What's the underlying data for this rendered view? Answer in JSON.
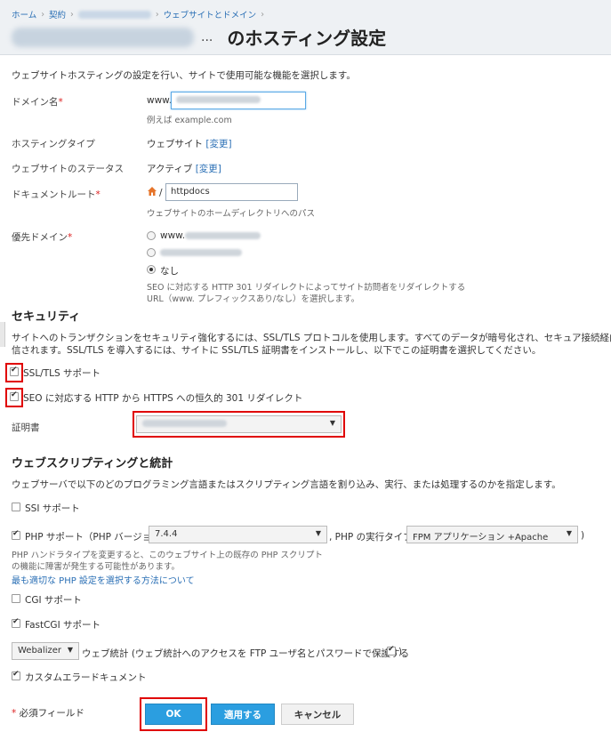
{
  "breadcrumb": {
    "home": "ホーム",
    "contract": "契約",
    "sites": "ウェブサイトとドメイン"
  },
  "page": {
    "dots": "...",
    "title_suffix": "のホスティング設定"
  },
  "intro": "ウェブサイトホスティングの設定を行い、サイトで使用可能な機能を選択します。",
  "domain": {
    "label": "ドメイン名",
    "required_mark": "*",
    "prefix": "www.",
    "hint": "例えば example.com"
  },
  "hosting_type": {
    "label": "ホスティングタイプ",
    "value": "ウェブサイト",
    "change": "[変更]"
  },
  "status": {
    "label": "ウェブサイトのステータス",
    "value": "アクティブ",
    "change": "[変更]"
  },
  "docroot": {
    "label": "ドキュメントルート",
    "required_mark": "*",
    "slash": "/",
    "value": "httpdocs",
    "hint": "ウェブサイトのホームディレクトリへのパス"
  },
  "preferred": {
    "label": "優先ドメイン",
    "required_mark": "*",
    "option1_prefix": "www.",
    "option3": "なし",
    "hint1": "SEO に対応する HTTP 301 リダイレクトによってサイト訪問者をリダイレクトする",
    "hint2": "URL（www. プレフィックスあり/なし）を選択します。"
  },
  "security": {
    "heading": "セキュリティ",
    "desc1": "サイトへのトランザクションをセキュリティ強化するには、SSL/TLS プロトコルを使用します。すべてのデータが暗号化され、セキュア接続経由で送",
    "desc2": "信されます。SSL/TLS を導入するには、サイトに SSL/TLS 証明書をインストールし、以下でこの証明書を選択してください。",
    "ssl_support": "SSL/TLS サポート",
    "redirect": "SEO に対応する HTTP から HTTPS への恒久的 301 リダイレクト",
    "cert_label": "証明書"
  },
  "scripting": {
    "heading": "ウェブスクリプティングと統計",
    "desc": "ウェブサーバで以下のどのプログラミング言語またはスクリプティング言語を割り込み、実行、または処理するのかを指定します。",
    "ssi": "SSI サポート",
    "php": "PHP サポート（PHP バージョン",
    "php_version": "7.4.4",
    "php_type_label": ", PHP の実行タイプ",
    "php_type": "FPM アプリケーション +Apache",
    "php_close": ")",
    "php_hint1": "PHP ハンドラタイプを変更すると、このウェブサイト上の既存の PHP スクリプト",
    "php_hint2": "の機能に障害が発生する可能性があります。",
    "php_link": "最も適切な PHP 設定を選択する方法について",
    "cgi": "CGI サポート",
    "fastcgi": "FastCGI サポート",
    "stats_tool": "Webalizer",
    "stats_label": "ウェブ統計 (ウェブ統計へのアクセスを FTP ユーザ名とパスワードで保護する",
    "stats_close": ")",
    "custom_errors": "カスタムエラードキュメント"
  },
  "footer": {
    "required_note_mark": "*",
    "required_note": "必須フィールド",
    "ok": "OK",
    "apply": "適用する",
    "cancel": "キャンセル"
  },
  "colors": {
    "accent": "#2b9ee0",
    "highlight": "#e00000",
    "link": "#2a6fb5"
  }
}
